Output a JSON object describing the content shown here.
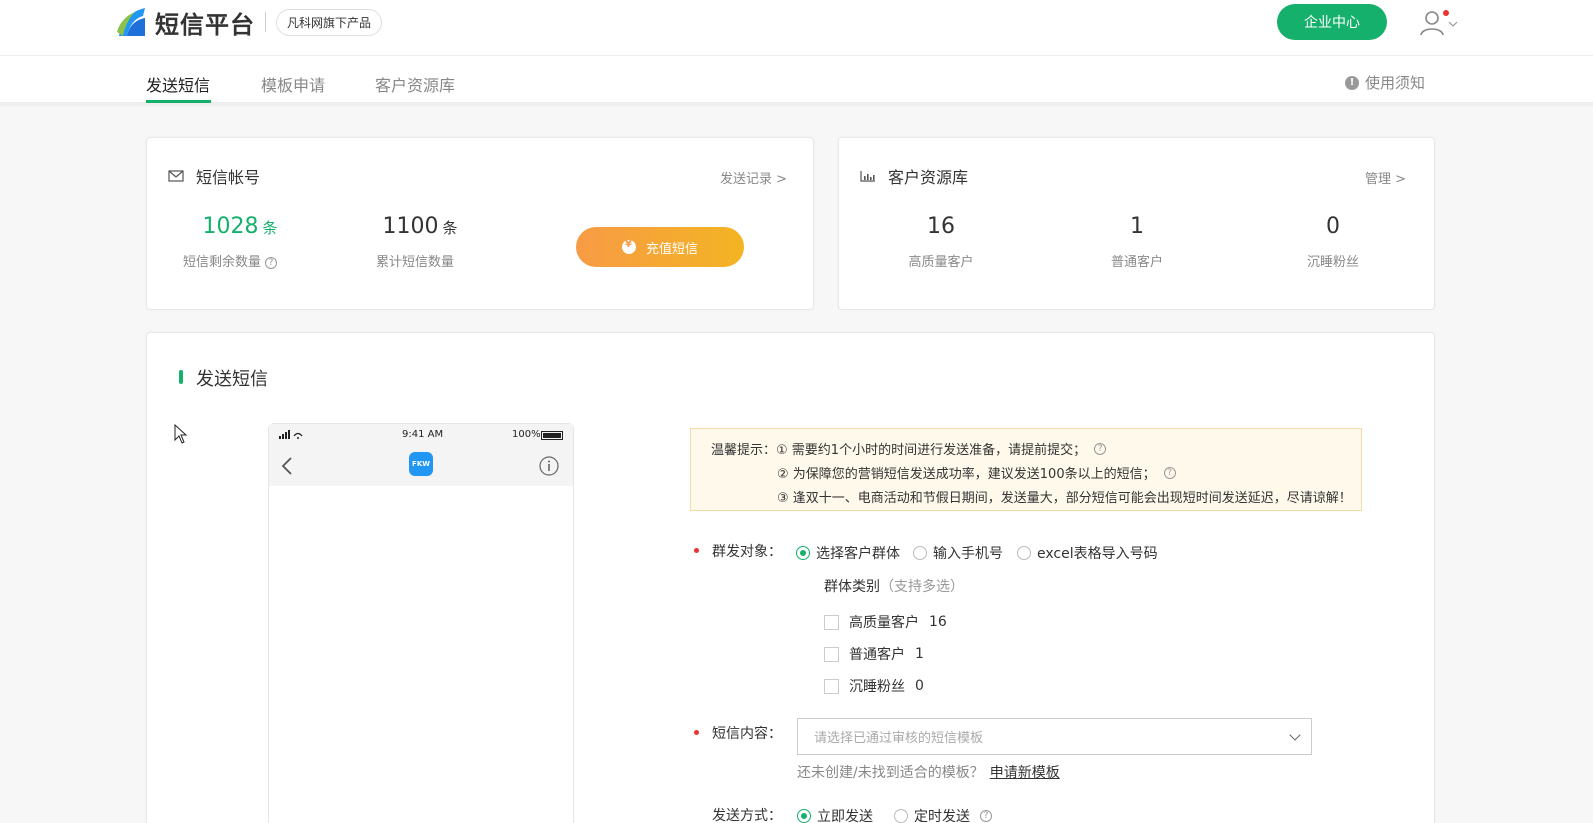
{
  "header": {
    "logo_text": "短信平台",
    "product_tag": "凡科网旗下产品",
    "enterprise_btn": "企业中心"
  },
  "nav": {
    "tabs": [
      "发送短信",
      "模板申请",
      "客户资源库"
    ],
    "notice": "使用须知"
  },
  "sms_account": {
    "title": "短信帐号",
    "link": "发送记录 >",
    "remaining_value": "1028",
    "remaining_unit": "条",
    "remaining_label": "短信剩余数量",
    "total_value": "1100",
    "total_unit": "条",
    "total_label": "累计短信数量",
    "recharge_btn": "充值短信"
  },
  "customer_lib": {
    "title": "客户资源库",
    "link": "管理 >",
    "stats": [
      {
        "value": "16",
        "label": "高质量客户"
      },
      {
        "value": "1",
        "label": "普通客户"
      },
      {
        "value": "0",
        "label": "沉睡粉丝"
      }
    ]
  },
  "send": {
    "title": "发送短信",
    "phone": {
      "time": "9:41 AM",
      "battery": "100%",
      "logo": "FKW"
    },
    "tips_prefix": "温馨提示：",
    "tips": [
      "① 需要约1个小时的时间进行发送准备，请提前提交；",
      "② 为保障您的营销短信发送成功率，建议发送100条以上的短信；",
      "③ 逢双十一、电商活动和节假日期间，发送量大，部分短信可能会出现短时间发送延迟，尽请谅解！"
    ],
    "target_label": "群发对象：",
    "target_options": [
      "选择客户群体",
      "输入手机号",
      "excel表格导入号码"
    ],
    "group_label": "群体类别",
    "group_note": "（支持多选）",
    "groups": [
      {
        "label": "高质量客户",
        "count": "16"
      },
      {
        "label": "普通客户",
        "count": "1"
      },
      {
        "label": "沉睡粉丝",
        "count": "0"
      }
    ],
    "content_label": "短信内容：",
    "content_placeholder": "请选择已通过审核的短信模板",
    "template_hint": "还未创建/未找到适合的模板？",
    "template_link": "申请新模板",
    "method_label": "发送方式：",
    "method_options": [
      "立即发送",
      "定时发送"
    ]
  },
  "colors": {
    "accent": "#15b06b",
    "orange": "#f79b45",
    "required": "#ee3333"
  }
}
